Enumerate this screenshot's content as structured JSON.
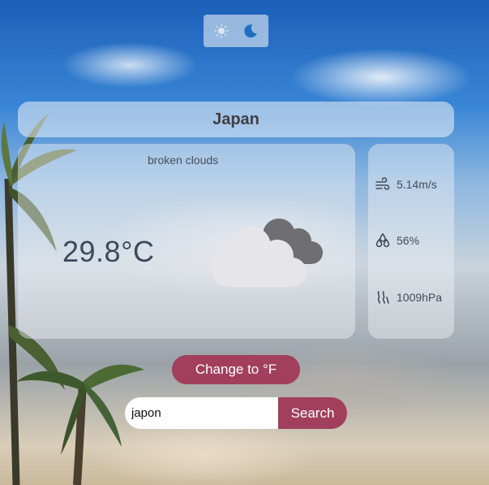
{
  "theme_toggle": {
    "light_icon": "sun-icon",
    "dark_icon": "moon-icon",
    "active": "dark"
  },
  "location": {
    "city": "Japan"
  },
  "weather": {
    "description": "broken clouds",
    "temperature": "29.8°C",
    "icon": "broken-clouds-icon"
  },
  "details": {
    "wind": {
      "icon": "wind-icon",
      "value": "5.14m/s"
    },
    "humidity": {
      "icon": "humidity-icon",
      "value": "56%"
    },
    "pressure": {
      "icon": "pressure-icon",
      "value": "1009hPa"
    }
  },
  "unit_toggle": {
    "label": "Change to °F"
  },
  "search": {
    "value": "japon",
    "button_label": "Search"
  },
  "colors": {
    "accent": "#a13f5d",
    "moon": "#1e6fc0"
  }
}
